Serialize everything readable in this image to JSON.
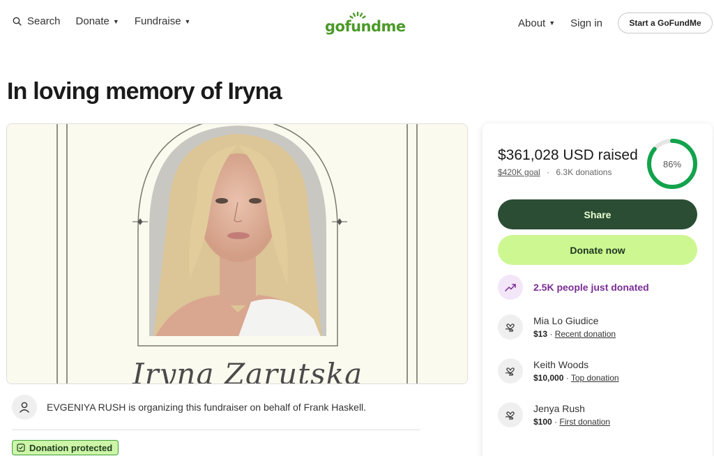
{
  "nav": {
    "search_label": "Search",
    "donate_label": "Donate",
    "fundraise_label": "Fundraise",
    "logo_text": "gofundme",
    "about_label": "About",
    "signin_label": "Sign in",
    "start_label": "Start a GoFundMe"
  },
  "page": {
    "title": "In loving memory of Iryna"
  },
  "hero": {
    "name_text": "Iryna Zarutska"
  },
  "organizer": {
    "text": "EVGENIYA RUSH is organizing this fundraiser on behalf of Frank Haskell."
  },
  "badge": {
    "protected_label": "Donation protected"
  },
  "campaign": {
    "raised": "$361,028 USD raised",
    "goal": "$420K goal",
    "separator": "·",
    "donations": "6.3K donations",
    "progress_percent": 86,
    "progress_label": "86%",
    "share_label": "Share",
    "donate_label": "Donate now",
    "trend_text": "2.5K people just donated"
  },
  "donors": [
    {
      "name": "Mia Lo Giudice",
      "amount": "$13",
      "sep": " · ",
      "type": "Recent donation"
    },
    {
      "name": "Keith Woods",
      "amount": "$10,000",
      "sep": " · ",
      "type": "Top donation"
    },
    {
      "name": "Jenya Rush",
      "amount": "$100",
      "sep": " · ",
      "type": "First donation"
    }
  ],
  "colors": {
    "brand_green": "#4c9a2a",
    "share_bg": "#2a4d33",
    "donate_bg": "#cdf791",
    "ring_green": "#12a34c",
    "trend_purple": "#7a2d94",
    "badge_bg": "#cdf5a8"
  }
}
